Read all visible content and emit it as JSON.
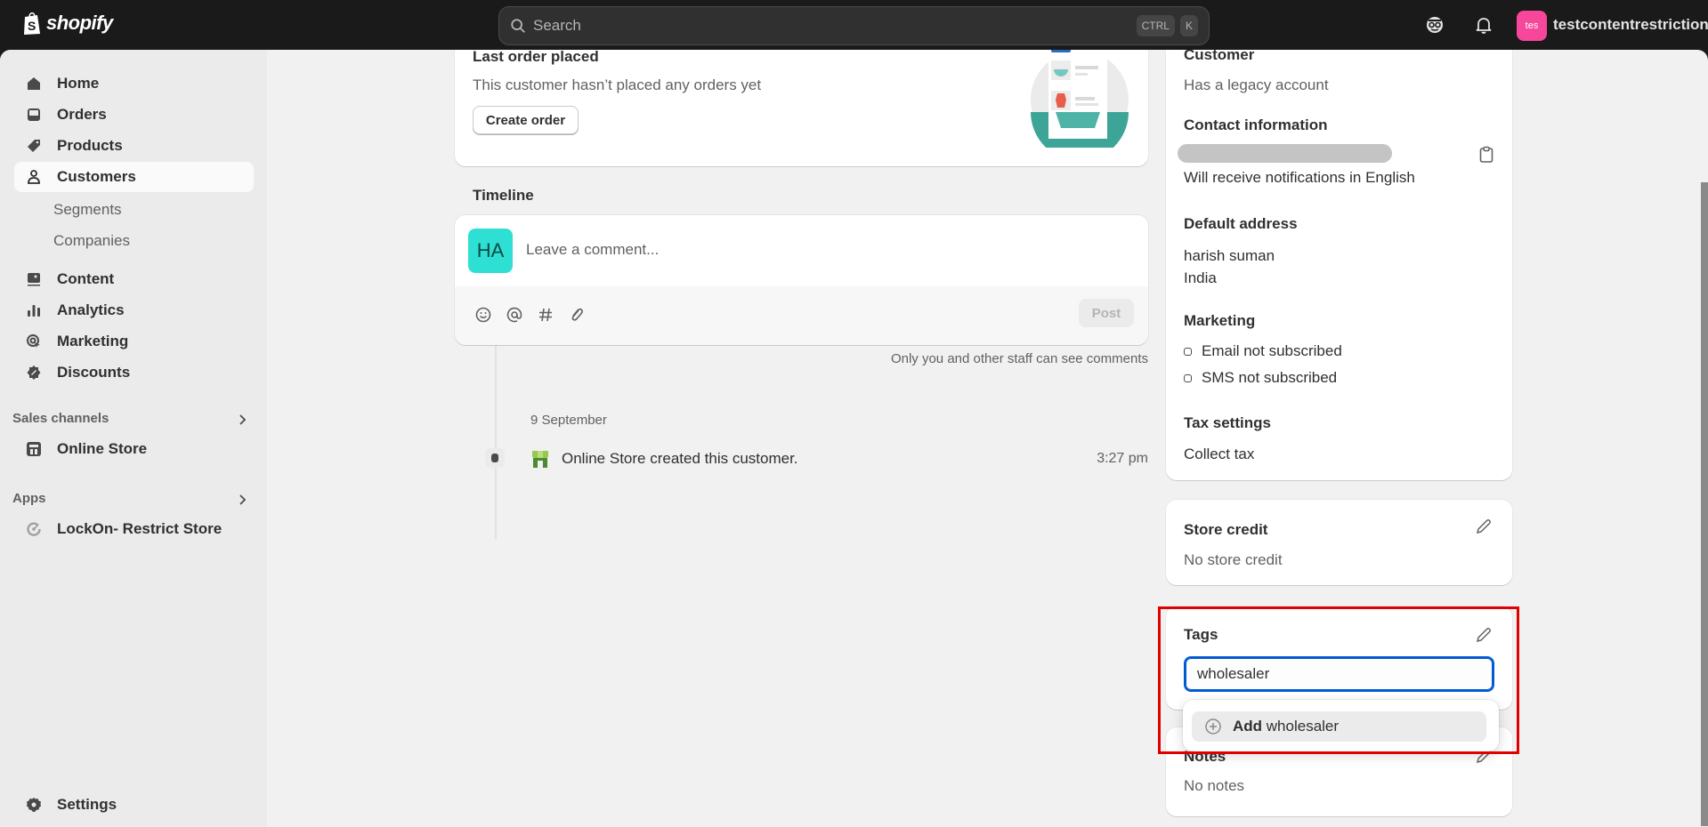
{
  "topbar": {
    "brand": "shopify",
    "search_placeholder": "Search",
    "shortcut_keys": [
      "CTRL",
      "K"
    ],
    "store_badge": "tes",
    "store_name": "testcontentrestriction"
  },
  "sidebar": {
    "items": [
      {
        "label": "Home",
        "icon": "home-icon"
      },
      {
        "label": "Orders",
        "icon": "inbox-icon"
      },
      {
        "label": "Products",
        "icon": "tag-icon"
      },
      {
        "label": "Customers",
        "icon": "person-icon",
        "active": true
      },
      {
        "label": "Segments",
        "sub": true
      },
      {
        "label": "Companies",
        "sub": true
      },
      {
        "label": "Content",
        "icon": "image-icon"
      },
      {
        "label": "Analytics",
        "icon": "bar-chart-icon"
      },
      {
        "label": "Marketing",
        "icon": "target-icon"
      },
      {
        "label": "Discounts",
        "icon": "discount-icon"
      }
    ],
    "sales_channels": {
      "title": "Sales channels",
      "items": [
        {
          "label": "Online Store"
        }
      ]
    },
    "apps": {
      "title": "Apps",
      "items": [
        {
          "label": "LockOn- Restrict Store"
        }
      ]
    },
    "settings": "Settings"
  },
  "main": {
    "last_order": {
      "title": "Last order placed",
      "message": "This customer hasn’t placed any orders yet",
      "button": "Create order"
    },
    "timeline": {
      "title": "Timeline",
      "avatar_initials": "HA",
      "comment_placeholder": "Leave a comment...",
      "post_button": "Post",
      "visibility_note": "Only you and other staff can see comments",
      "events": [
        {
          "date": "9 September",
          "text": "Online Store created this customer.",
          "time": "3:27 pm"
        }
      ]
    }
  },
  "customer_panel": {
    "customer_title": "Customer",
    "legacy": "Has a legacy account",
    "contact_title": "Contact information",
    "notifications": "Will receive notifications in English",
    "address_title": "Default address",
    "address_lines": [
      "harish suman",
      "India"
    ],
    "marketing_title": "Marketing",
    "marketing": [
      "Email not subscribed",
      "SMS not subscribed"
    ],
    "tax_title": "Tax settings",
    "tax_value": "Collect tax"
  },
  "store_credit": {
    "title": "Store credit",
    "value": "No store credit"
  },
  "tags": {
    "title": "Tags",
    "input_value": "wholesaler",
    "suggestion_prefix": "Add",
    "suggestion_value": "wholesaler"
  },
  "notes": {
    "title": "Notes",
    "value": "No notes"
  },
  "colors": {
    "accent": "#005bd3",
    "highlight": "#e00000",
    "store_badge": "#f6479a",
    "avatar": "#2ee0d3"
  }
}
